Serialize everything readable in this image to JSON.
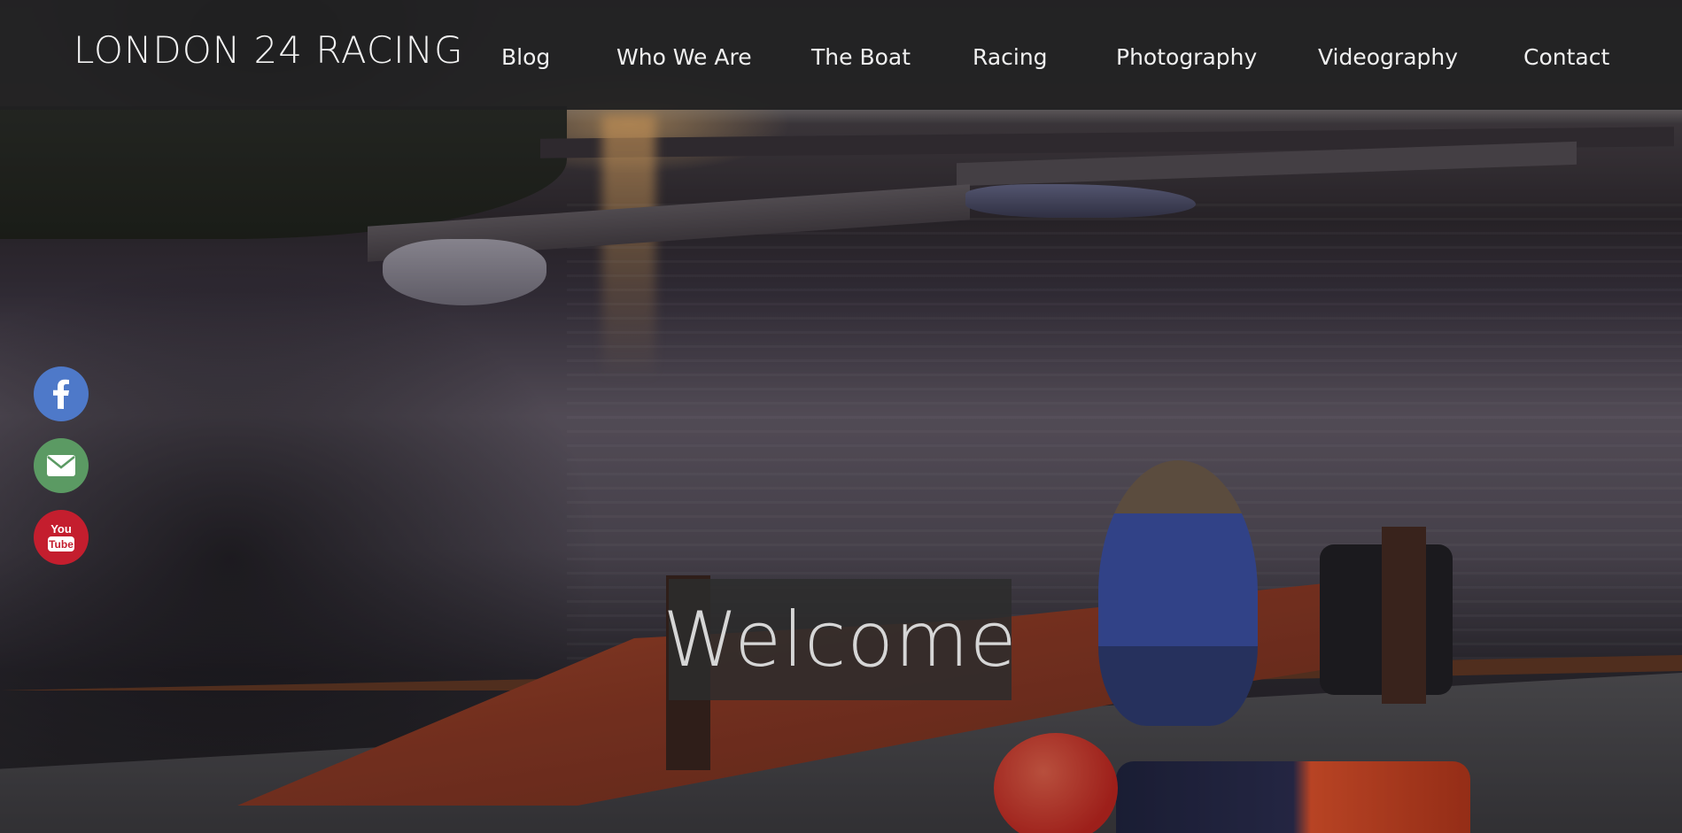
{
  "brand": {
    "title": "LONDON 24 RACING"
  },
  "nav": {
    "items": [
      {
        "label": "Blog"
      },
      {
        "label": "Who We Are"
      },
      {
        "label": "The Boat"
      },
      {
        "label": "Racing"
      },
      {
        "label": "Photography"
      },
      {
        "label": "Videography"
      },
      {
        "label": "Contact"
      }
    ]
  },
  "social": [
    {
      "icon": "facebook-icon",
      "color": "#4e79c9"
    },
    {
      "icon": "mail-icon",
      "color": "#5b9a63"
    },
    {
      "icon": "youtube-icon",
      "color": "#c41e2e",
      "text_top": "You",
      "text_bottom": "Tube"
    }
  ],
  "hero": {
    "banner": "Welcome"
  },
  "colors": {
    "header_bg": "#202021",
    "text": "#f0f0f0",
    "banner_bg": "#2c2c2c",
    "banner_text": "#d6d6d6"
  }
}
